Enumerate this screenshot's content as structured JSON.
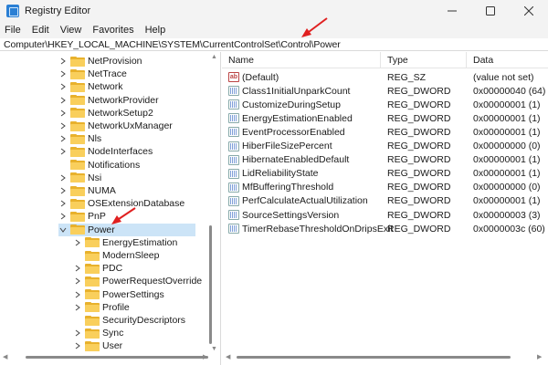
{
  "window": {
    "title": "Registry Editor"
  },
  "menu": [
    "File",
    "Edit",
    "View",
    "Favorites",
    "Help"
  ],
  "address": "Computer\\HKEY_LOCAL_MACHINE\\SYSTEM\\CurrentControlSet\\Control\\Power",
  "tree": [
    {
      "label": "NetProvision",
      "level": 0,
      "expander": "collapsed"
    },
    {
      "label": "NetTrace",
      "level": 0,
      "expander": "collapsed"
    },
    {
      "label": "Network",
      "level": 0,
      "expander": "collapsed"
    },
    {
      "label": "NetworkProvider",
      "level": 0,
      "expander": "collapsed"
    },
    {
      "label": "NetworkSetup2",
      "level": 0,
      "expander": "collapsed"
    },
    {
      "label": "NetworkUxManager",
      "level": 0,
      "expander": "collapsed"
    },
    {
      "label": "Nls",
      "level": 0,
      "expander": "collapsed"
    },
    {
      "label": "NodeInterfaces",
      "level": 0,
      "expander": "collapsed"
    },
    {
      "label": "Notifications",
      "level": 0,
      "expander": "none"
    },
    {
      "label": "Nsi",
      "level": 0,
      "expander": "collapsed"
    },
    {
      "label": "NUMA",
      "level": 0,
      "expander": "collapsed"
    },
    {
      "label": "OSExtensionDatabase",
      "level": 0,
      "expander": "collapsed"
    },
    {
      "label": "PnP",
      "level": 0,
      "expander": "collapsed"
    },
    {
      "label": "Power",
      "level": 0,
      "expander": "expanded",
      "selected": true
    },
    {
      "label": "EnergyEstimation",
      "level": 1,
      "expander": "collapsed"
    },
    {
      "label": "ModernSleep",
      "level": 1,
      "expander": "none"
    },
    {
      "label": "PDC",
      "level": 1,
      "expander": "collapsed"
    },
    {
      "label": "PowerRequestOverride",
      "level": 1,
      "expander": "collapsed"
    },
    {
      "label": "PowerSettings",
      "level": 1,
      "expander": "collapsed"
    },
    {
      "label": "Profile",
      "level": 1,
      "expander": "collapsed"
    },
    {
      "label": "SecurityDescriptors",
      "level": 1,
      "expander": "none"
    },
    {
      "label": "Sync",
      "level": 1,
      "expander": "collapsed"
    },
    {
      "label": "User",
      "level": 1,
      "expander": "collapsed"
    }
  ],
  "columns": [
    "Name",
    "Type",
    "Data"
  ],
  "values": [
    {
      "name": "(Default)",
      "type": "REG_SZ",
      "data": "(value not set)",
      "icon": "string-value-icon"
    },
    {
      "name": "Class1InitialUnparkCount",
      "type": "REG_DWORD",
      "data": "0x00000040 (64)",
      "icon": "binary-value-icon"
    },
    {
      "name": "CustomizeDuringSetup",
      "type": "REG_DWORD",
      "data": "0x00000001 (1)",
      "icon": "binary-value-icon"
    },
    {
      "name": "EnergyEstimationEnabled",
      "type": "REG_DWORD",
      "data": "0x00000001 (1)",
      "icon": "binary-value-icon"
    },
    {
      "name": "EventProcessorEnabled",
      "type": "REG_DWORD",
      "data": "0x00000001 (1)",
      "icon": "binary-value-icon"
    },
    {
      "name": "HiberFileSizePercent",
      "type": "REG_DWORD",
      "data": "0x00000000 (0)",
      "icon": "binary-value-icon"
    },
    {
      "name": "HibernateEnabledDefault",
      "type": "REG_DWORD",
      "data": "0x00000001 (1)",
      "icon": "binary-value-icon"
    },
    {
      "name": "LidReliabilityState",
      "type": "REG_DWORD",
      "data": "0x00000001 (1)",
      "icon": "binary-value-icon"
    },
    {
      "name": "MfBufferingThreshold",
      "type": "REG_DWORD",
      "data": "0x00000000 (0)",
      "icon": "binary-value-icon"
    },
    {
      "name": "PerfCalculateActualUtilization",
      "type": "REG_DWORD",
      "data": "0x00000001 (1)",
      "icon": "binary-value-icon"
    },
    {
      "name": "SourceSettingsVersion",
      "type": "REG_DWORD",
      "data": "0x00000003 (3)",
      "icon": "binary-value-icon"
    },
    {
      "name": "TimerRebaseThresholdOnDripsExit",
      "type": "REG_DWORD",
      "data": "0x0000003c (60)",
      "icon": "binary-value-icon"
    }
  ],
  "colors": {
    "accent_arrow": "#e02020",
    "selection": "#cce4f7",
    "folder": "#f9cf5c"
  }
}
